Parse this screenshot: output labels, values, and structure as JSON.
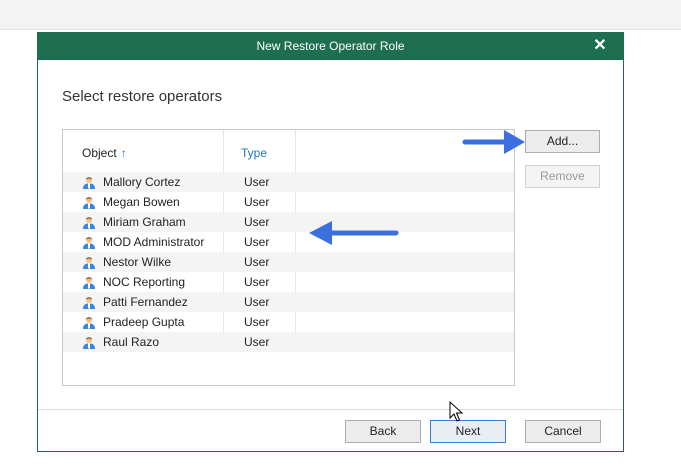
{
  "dialog": {
    "title": "New Restore Operator Role",
    "close_glyph": "✕",
    "heading": "Select restore operators"
  },
  "grid": {
    "columns": {
      "object": "Object",
      "sort_glyph": "↑",
      "type": "Type"
    },
    "rows": [
      {
        "name": "Mallory Cortez",
        "type": "User"
      },
      {
        "name": "Megan Bowen",
        "type": "User"
      },
      {
        "name": "Miriam Graham",
        "type": "User"
      },
      {
        "name": "MOD Administrator",
        "type": "User"
      },
      {
        "name": "Nestor Wilke",
        "type": "User"
      },
      {
        "name": "NOC Reporting",
        "type": "User"
      },
      {
        "name": "Patti Fernandez",
        "type": "User"
      },
      {
        "name": "Pradeep Gupta",
        "type": "User"
      },
      {
        "name": "Raul Razo",
        "type": "User"
      }
    ],
    "row_icon": "user-icon"
  },
  "buttons": {
    "add": "Add...",
    "remove": "Remove",
    "back": "Back",
    "next": "Next",
    "cancel": "Cancel"
  },
  "annotations": {
    "arrow_color": "#3b6fe0",
    "arrows": [
      "arrow-pointing-to-add-button",
      "arrow-pointing-to-user-list"
    ]
  },
  "colors": {
    "titlebar": "#1e6f4f",
    "sort_accent": "#1e74c8"
  }
}
